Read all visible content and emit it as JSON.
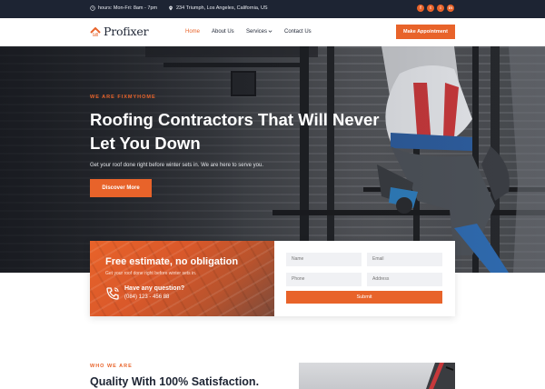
{
  "topbar": {
    "hours": "hours: Mon-Fri: 8am - 7pm",
    "address": "234 Triumph, Los Angeles, California, US",
    "socials": [
      {
        "icon": "facebook-icon",
        "glyph": "f"
      },
      {
        "icon": "twitter-icon",
        "glyph": "t"
      },
      {
        "icon": "instagram-icon",
        "glyph": "i"
      },
      {
        "icon": "linkedin-icon",
        "glyph": "in"
      }
    ]
  },
  "nav": {
    "logo": "Profixer",
    "items": [
      "Home",
      "About Us",
      "Services",
      "Contact Us"
    ],
    "active": "Home",
    "cta": "Make Appointment"
  },
  "hero": {
    "eyebrow": "WE ARE FIXMYHOME",
    "title": "Roofing Contractors That Will Never Let You Down",
    "subtitle": "Get your roof done right before winter sets in. We are here to serve you.",
    "button": "Discover More"
  },
  "estimate": {
    "title": "Free estimate, no obligation",
    "subtitle": "Get your roof done right before winter sets in.",
    "question": "Have any question?",
    "phone": "(084) 123 - 456 88",
    "form": {
      "name_placeholder": "Name",
      "email_placeholder": "Email",
      "phone_placeholder": "Phone",
      "address_placeholder": "Address",
      "submit": "Submit"
    }
  },
  "who": {
    "eyebrow": "WHO WE ARE",
    "title": "Quality With 100% Satisfaction."
  },
  "colors": {
    "accent": "#e8632a",
    "dark": "#1d2433"
  }
}
